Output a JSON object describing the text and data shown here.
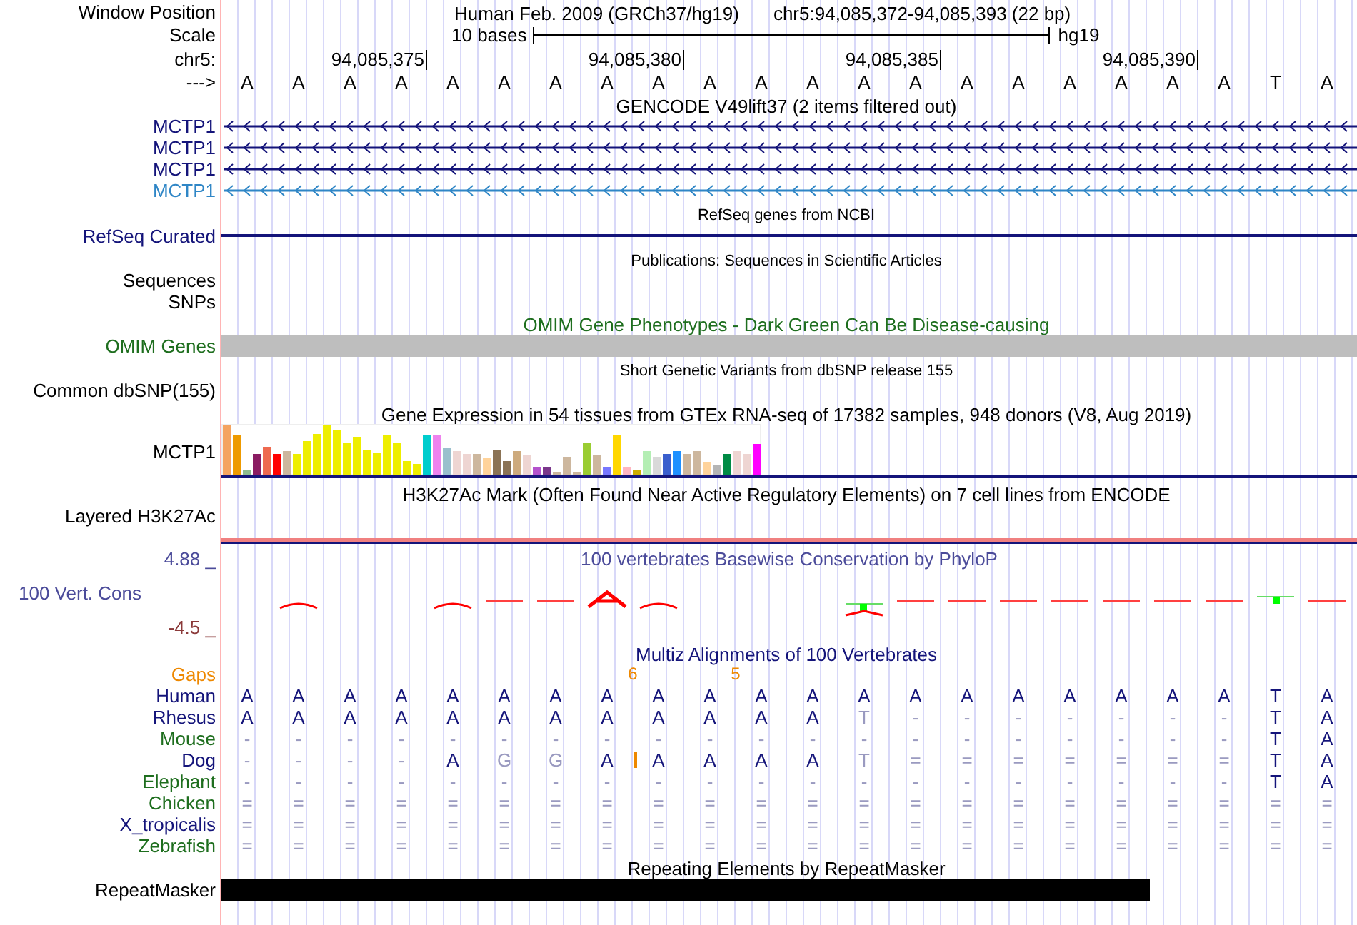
{
  "window_position": {
    "label": "Window Position",
    "assembly": "Human Feb. 2009 (GRCh37/hg19)",
    "position": "chr5:94,085,372-94,085,393 (22 bp)"
  },
  "scale": {
    "label": "Scale",
    "text": "10 bases",
    "assembly": "hg19"
  },
  "ruler": {
    "label": "chr5:",
    "ticks": [
      "94,085,375",
      "94,085,380",
      "94,085,385",
      "94,085,390"
    ]
  },
  "sequence": {
    "label": "--->",
    "bases": [
      "A",
      "A",
      "A",
      "A",
      "A",
      "A",
      "A",
      "A",
      "A",
      "A",
      "A",
      "A",
      "A",
      "A",
      "A",
      "A",
      "A",
      "A",
      "A",
      "A",
      "T",
      "A"
    ]
  },
  "tracks": [
    {
      "kind": "gene",
      "title": "GENCODE V49lift37 (2 items filtered out)",
      "items": [
        {
          "name": "MCTP1",
          "color": "#14147a"
        },
        {
          "name": "MCTP1",
          "color": "#14147a"
        },
        {
          "name": "MCTP1",
          "color": "#14147a"
        },
        {
          "name": "MCTP1",
          "color": "#2f86c6"
        }
      ]
    },
    {
      "kind": "line",
      "title": "RefSeq genes from NCBI",
      "label": "RefSeq Curated",
      "color": "#14147a"
    },
    {
      "kind": "empty",
      "title": "Publications: Sequences in Scientific Articles",
      "labels": [
        "Sequences",
        "SNPs"
      ]
    },
    {
      "kind": "bar",
      "title": "OMIM Gene Phenotypes - Dark Green Can Be Disease-causing",
      "label": "OMIM Genes"
    },
    {
      "kind": "empty",
      "title": "Short Genetic Variants from dbSNP release 155",
      "labels": [
        "Common dbSNP(155)"
      ]
    },
    {
      "kind": "expression",
      "title": "Gene Expression in 54 tissues from GTEx RNA-seq of 17382 samples, 948 donors (V8, Aug 2019)",
      "label": "MCTP1"
    },
    {
      "kind": "layered",
      "title": "H3K27Ac Mark (Often Found Near Active Regulatory Elements) on 7 cell lines from ENCODE",
      "label": "Layered H3K27Ac"
    },
    {
      "kind": "wiggle",
      "title": "100 vertebrates Basewise Conservation by PhyloP",
      "label": "100 Vert. Cons",
      "max": "4.88 _",
      "min": "-4.5 _"
    },
    {
      "kind": "multiz",
      "title": "Multiz Alignments of 100 Vertebrates",
      "gaps": {
        "label": "Gaps",
        "marks": [
          "6",
          "5"
        ]
      },
      "species": [
        {
          "name": "Human",
          "color": "#14147a",
          "bases": [
            "A",
            "A",
            "A",
            "A",
            "A",
            "A",
            "A",
            "A",
            "A",
            "A",
            "A",
            "A",
            "A",
            "A",
            "A",
            "A",
            "A",
            "A",
            "A",
            "A",
            "T",
            "A"
          ],
          "dim": [
            false,
            false,
            false,
            false,
            false,
            false,
            false,
            false,
            false,
            false,
            false,
            false,
            false,
            false,
            false,
            false,
            false,
            false,
            false,
            false,
            false,
            false
          ],
          "insertion": false
        },
        {
          "name": "Rhesus",
          "color": "#14147a",
          "bases": [
            "A",
            "A",
            "A",
            "A",
            "A",
            "A",
            "A",
            "A",
            "A",
            "A",
            "A",
            "A",
            "T",
            "-",
            "-",
            "-",
            "-",
            "-",
            "-",
            "-",
            "T",
            "A"
          ],
          "dim": [
            false,
            false,
            false,
            false,
            false,
            false,
            false,
            false,
            false,
            false,
            false,
            false,
            true,
            true,
            true,
            true,
            true,
            true,
            true,
            true,
            false,
            false
          ],
          "insertion": false
        },
        {
          "name": "Mouse",
          "color": "#1e6e1e",
          "bases": [
            "-",
            "-",
            "-",
            "-",
            "-",
            "-",
            "-",
            "-",
            "-",
            "-",
            "-",
            "-",
            "-",
            "-",
            "-",
            "-",
            "-",
            "-",
            "-",
            "-",
            "T",
            "A"
          ],
          "dim": [
            true,
            true,
            true,
            true,
            true,
            true,
            true,
            true,
            true,
            true,
            true,
            true,
            true,
            true,
            true,
            true,
            true,
            true,
            true,
            true,
            false,
            false
          ],
          "insertion": false
        },
        {
          "name": "Dog",
          "color": "#14147a",
          "bases": [
            "-",
            "-",
            "-",
            "-",
            "A",
            "G",
            "G",
            "A",
            "A",
            "A",
            "A",
            "A",
            "T",
            "=",
            "=",
            "=",
            "=",
            "=",
            "=",
            "=",
            "T",
            "A"
          ],
          "dim": [
            true,
            true,
            true,
            true,
            false,
            true,
            true,
            false,
            false,
            false,
            false,
            false,
            true,
            true,
            true,
            true,
            true,
            true,
            true,
            true,
            false,
            false
          ],
          "insertion": true
        },
        {
          "name": "Elephant",
          "color": "#1e6e1e",
          "bases": [
            "-",
            "-",
            "-",
            "-",
            "-",
            "-",
            "-",
            "-",
            "-",
            "-",
            "-",
            "-",
            "-",
            "-",
            "-",
            "-",
            "-",
            "-",
            "-",
            "-",
            "T",
            "A"
          ],
          "dim": [
            true,
            true,
            true,
            true,
            true,
            true,
            true,
            true,
            true,
            true,
            true,
            true,
            true,
            true,
            true,
            true,
            true,
            true,
            true,
            true,
            false,
            false
          ],
          "insertion": false
        },
        {
          "name": "Chicken",
          "color": "#1e6e1e",
          "bases": [
            "=",
            "=",
            "=",
            "=",
            "=",
            "=",
            "=",
            "=",
            "=",
            "=",
            "=",
            "=",
            "=",
            "=",
            "=",
            "=",
            "=",
            "=",
            "=",
            "=",
            "=",
            "="
          ],
          "dim": [
            true,
            true,
            true,
            true,
            true,
            true,
            true,
            true,
            true,
            true,
            true,
            true,
            true,
            true,
            true,
            true,
            true,
            true,
            true,
            true,
            true,
            true
          ],
          "insertion": false
        },
        {
          "name": "X_tropicalis",
          "color": "#14147a",
          "bases": [
            "=",
            "=",
            "=",
            "=",
            "=",
            "=",
            "=",
            "=",
            "=",
            "=",
            "=",
            "=",
            "=",
            "=",
            "=",
            "=",
            "=",
            "=",
            "=",
            "=",
            "=",
            "="
          ],
          "dim": [
            true,
            true,
            true,
            true,
            true,
            true,
            true,
            true,
            true,
            true,
            true,
            true,
            true,
            true,
            true,
            true,
            true,
            true,
            true,
            true,
            true,
            true
          ],
          "insertion": false
        },
        {
          "name": "Zebrafish",
          "color": "#1e6e1e",
          "bases": [
            "=",
            "=",
            "=",
            "=",
            "=",
            "=",
            "=",
            "=",
            "=",
            "=",
            "=",
            "=",
            "=",
            "=",
            "=",
            "=",
            "=",
            "=",
            "=",
            "=",
            "=",
            "="
          ],
          "dim": [
            true,
            true,
            true,
            true,
            true,
            true,
            true,
            true,
            true,
            true,
            true,
            true,
            true,
            true,
            true,
            true,
            true,
            true,
            true,
            true,
            true,
            true
          ],
          "insertion": false
        }
      ]
    },
    {
      "kind": "repeat",
      "title": "Repeating Elements by RepeatMasker",
      "label": "RepeatMasker"
    }
  ]
}
